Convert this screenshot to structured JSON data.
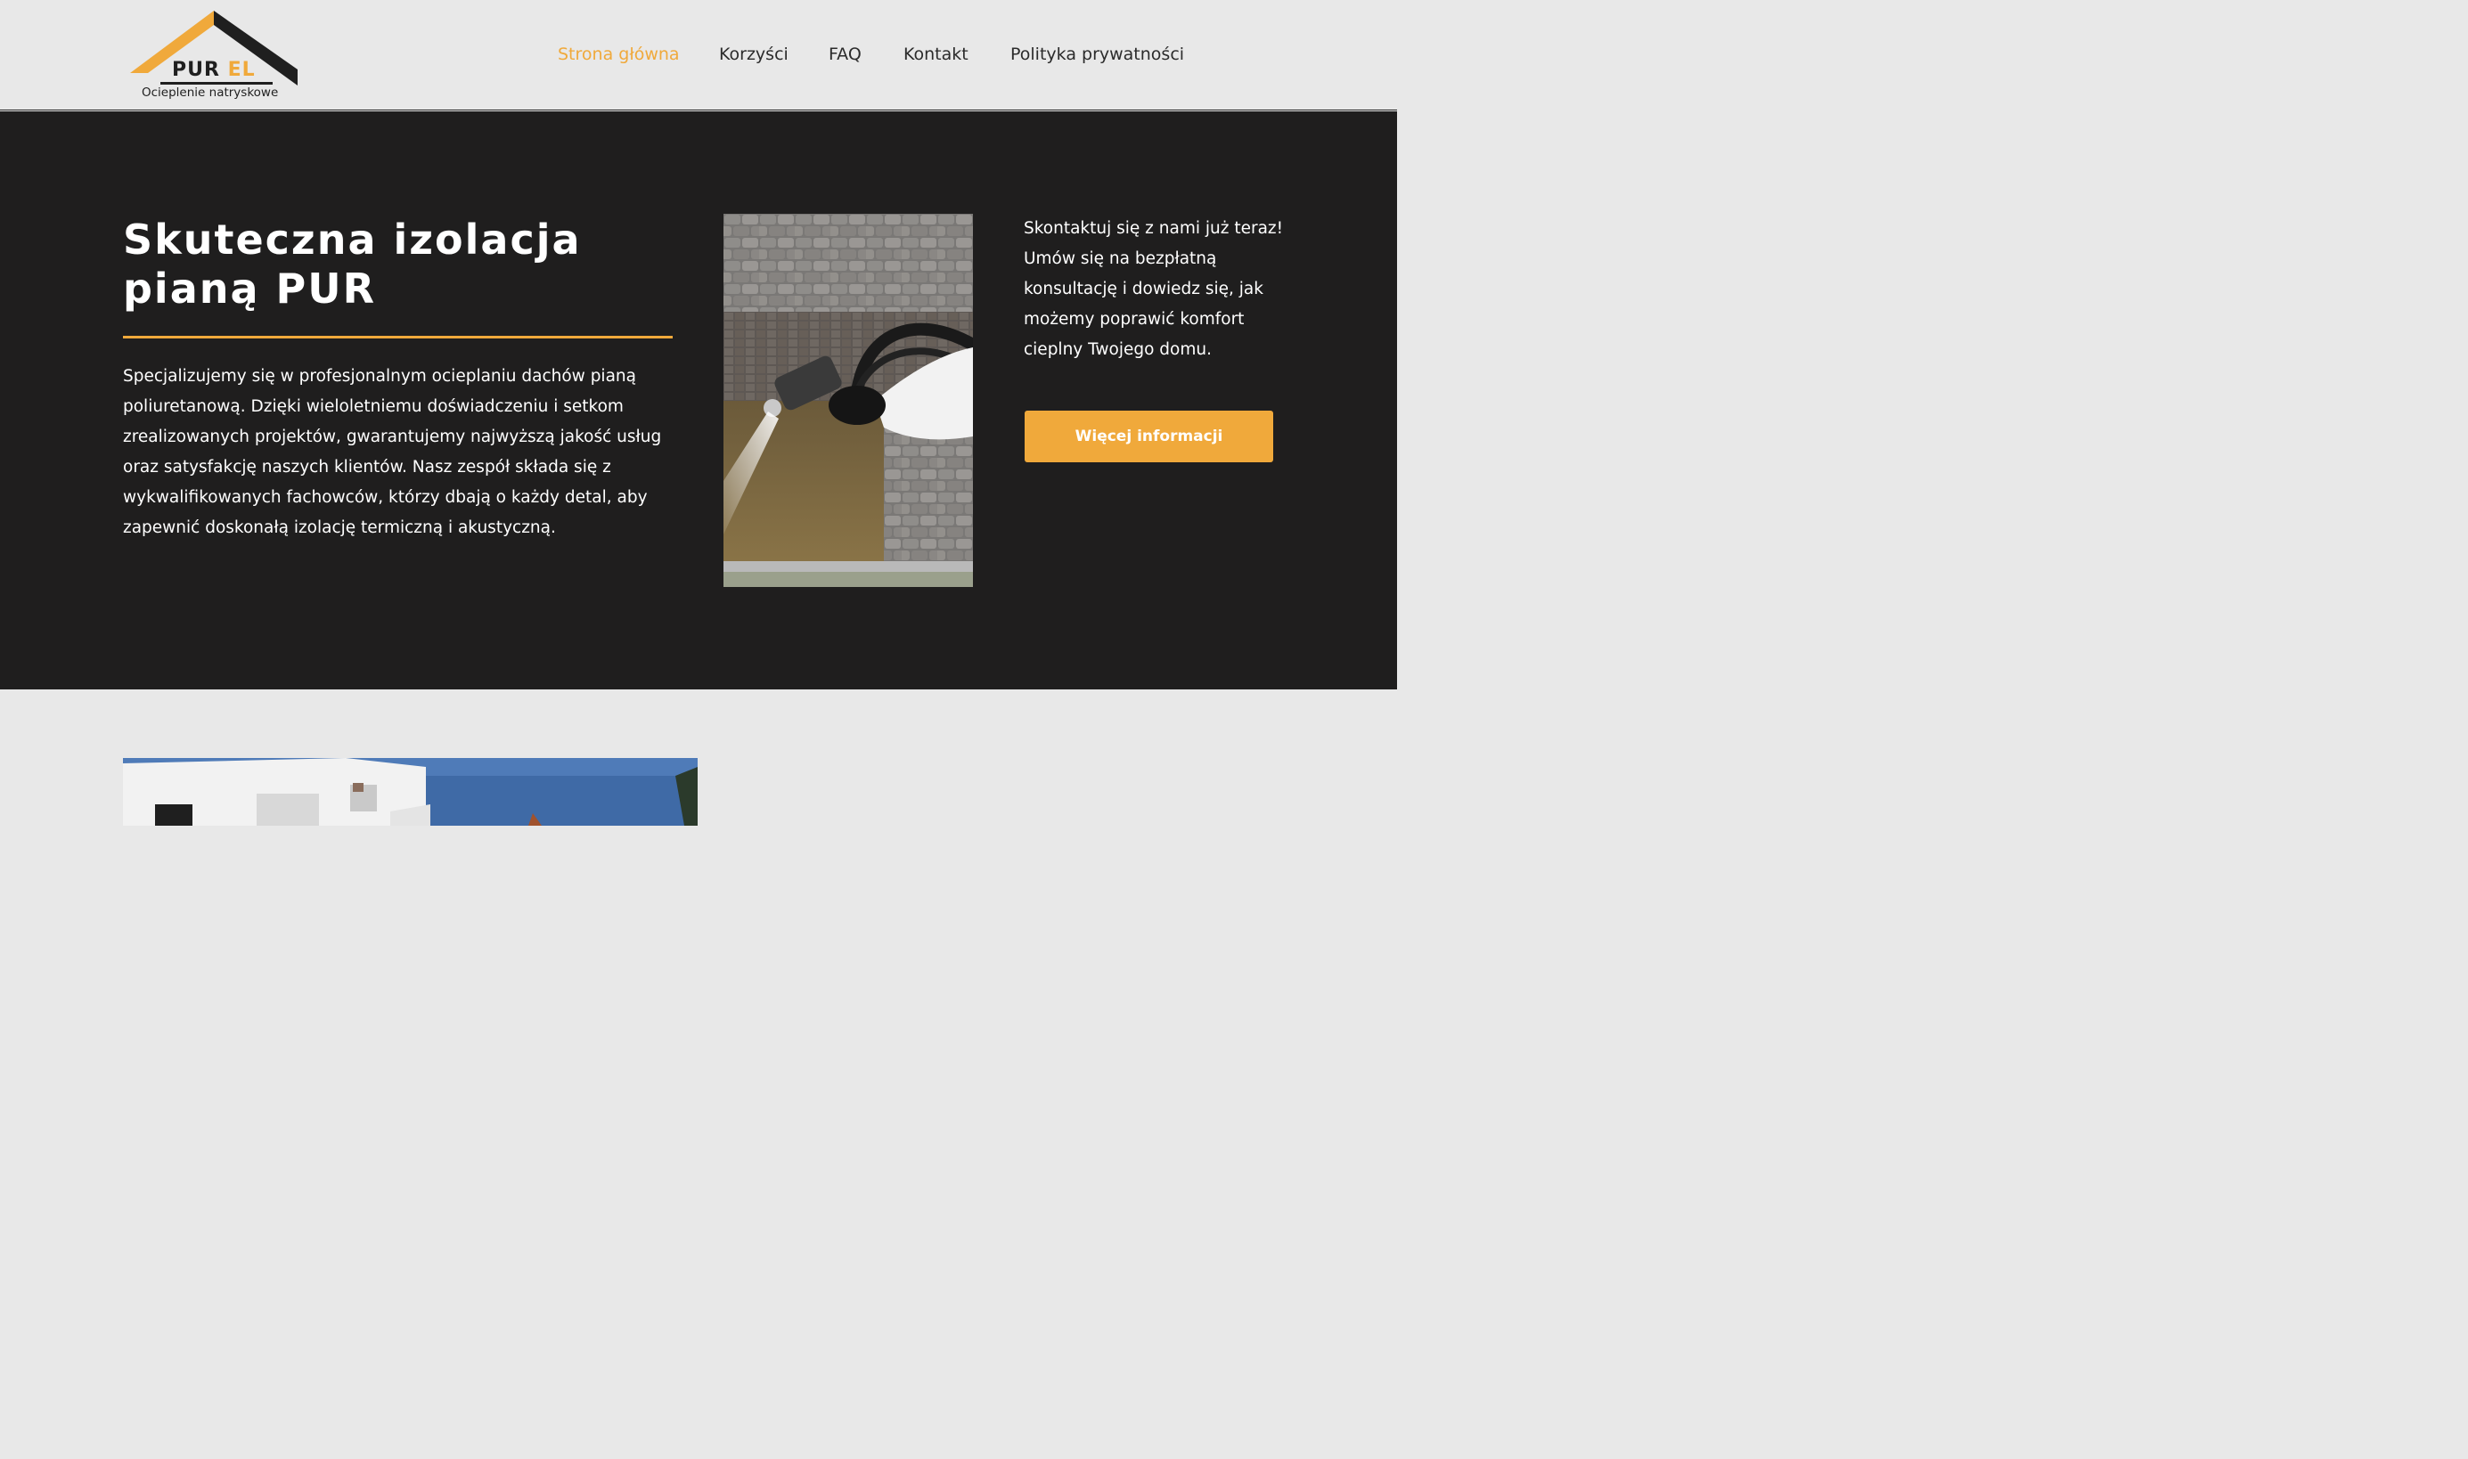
{
  "header": {
    "logo": {
      "word_main": "PUR",
      "word_accent": "EL",
      "tagline": "Ocieplenie natryskowe"
    },
    "nav": [
      {
        "label": "Strona główna",
        "active": true
      },
      {
        "label": "Korzyści",
        "active": false
      },
      {
        "label": "FAQ",
        "active": false
      },
      {
        "label": "Kontakt",
        "active": false
      },
      {
        "label": "Polityka prywatności",
        "active": false
      }
    ]
  },
  "hero": {
    "title": "Skuteczna izolacja pianą PUR",
    "description": "Specjalizujemy się w profesjonalnym ocieplaniu dachów pianą poliuretanową. Dzięki wieloletniemu doświadczeniu i setkom zrealizowanych projektów, gwarantujemy najwyższą jakość usług oraz satysfakcję naszych klientów. Nasz zespół składa się z wykwalifikowanych fachowców, którzy dbają o każdy detal, aby zapewnić doskonałą izolację termiczną i akustyczną.",
    "cta_text": "Skontaktuj się z nami już teraz! Umów się na bezpłatną konsultację i dowiedz się, jak możemy poprawić komfort cieplny Twojego domu.",
    "button_label": "Więcej informacji"
  },
  "colors": {
    "accent": "#f0a93b",
    "dark": "#1f1e1e",
    "light_bg": "#e8e8e8"
  }
}
